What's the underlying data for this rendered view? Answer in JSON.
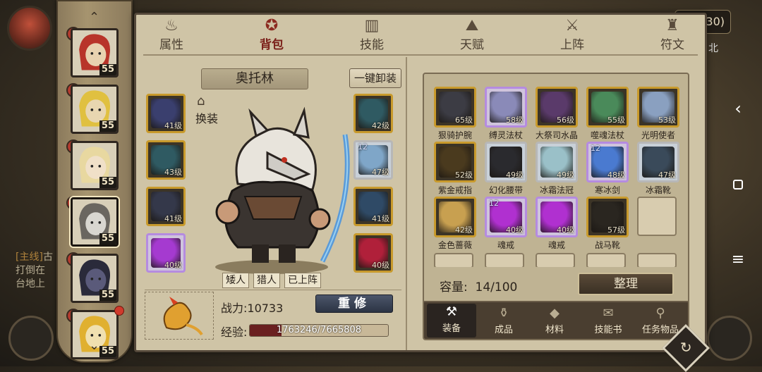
{
  "background": {
    "coords": "05,30)",
    "north_label": "北",
    "chat_lines": [
      {
        "tag": "[主线]",
        "text": "古"
      },
      {
        "tag": "",
        "text": "打倒在"
      },
      {
        "tag": "",
        "text": "台地上"
      }
    ]
  },
  "hero_strip": {
    "heroes": [
      {
        "level": "55",
        "palette": "red-hair",
        "selected": false
      },
      {
        "level": "55",
        "palette": "blond",
        "selected": false
      },
      {
        "level": "55",
        "palette": "elf",
        "selected": false
      },
      {
        "level": "55",
        "palette": "wolf",
        "selected": true
      },
      {
        "level": "55",
        "palette": "dark",
        "selected": false
      },
      {
        "level": "55",
        "palette": "gold",
        "selected": false
      }
    ]
  },
  "tabs": [
    {
      "label": "属性",
      "icon": "flame-icon",
      "glyph": "♨",
      "active": false
    },
    {
      "label": "背包",
      "icon": "backpack-icon",
      "glyph": "✪",
      "active": true
    },
    {
      "label": "技能",
      "icon": "book-icon",
      "glyph": "▥",
      "active": false
    },
    {
      "label": "天赋",
      "icon": "mountain-icon",
      "glyph": "⛰",
      "active": false
    },
    {
      "label": "上阵",
      "icon": "crossed-swords-icon",
      "glyph": "⚔",
      "active": false
    },
    {
      "label": "符文",
      "icon": "rune-icon",
      "glyph": "♜",
      "active": false
    }
  ],
  "hero": {
    "name": "奥托林",
    "unequip_all": "一键卸装",
    "swap_label": "换装",
    "tags": [
      "矮人",
      "猎人",
      "已上阵"
    ],
    "power_label": "战力:10733",
    "rebuild_label": "重修",
    "exp_label": "经验:",
    "exp_text": "1763246/7665808",
    "exp_fraction": 0.23
  },
  "equipped_left": [
    {
      "level": "41级",
      "rarity": "gold",
      "color": "#3a3f6e"
    },
    {
      "level": "43级",
      "rarity": "gold",
      "color": "#2f5a62"
    },
    {
      "level": "41级",
      "rarity": "gold",
      "color": "#34384a"
    },
    {
      "level": "40级",
      "rarity": "purple",
      "color": "#a53ad0"
    }
  ],
  "equipped_right": [
    {
      "level": "42级",
      "rarity": "gold",
      "color": "#2f5a62",
      "plus": ""
    },
    {
      "level": "47级",
      "rarity": "blue",
      "color": "#7fa6c8",
      "plus": "12"
    },
    {
      "level": "41级",
      "rarity": "gold",
      "color": "#2f4a66",
      "plus": ""
    },
    {
      "level": "40级",
      "rarity": "gold",
      "color": "#b0203a",
      "plus": ""
    }
  ],
  "bag": {
    "items": [
      {
        "name": "狠骑护腕",
        "level": "65级",
        "rarity": "gold",
        "color": "#3c3c44",
        "plus": ""
      },
      {
        "name": "缚灵法杖",
        "level": "58级",
        "rarity": "purple",
        "color": "#8a8ab8",
        "plus": ""
      },
      {
        "name": "大祭司水晶",
        "level": "56级",
        "rarity": "gold",
        "color": "#5a3a6a",
        "plus": ""
      },
      {
        "name": "噬魂法杖",
        "level": "55级",
        "rarity": "gold",
        "color": "#4a8a5a",
        "plus": ""
      },
      {
        "name": "光明使者",
        "level": "53级",
        "rarity": "gold",
        "color": "#8aa0c0",
        "plus": ""
      },
      {
        "name": "紫金戒指",
        "level": "52级",
        "rarity": "gold",
        "color": "#4a3a1e",
        "plus": ""
      },
      {
        "name": "幻化腰带",
        "level": "49级",
        "rarity": "gray",
        "color": "#2a2a2e",
        "plus": ""
      },
      {
        "name": "冰霜法冠",
        "level": "49级",
        "rarity": "green",
        "color": "#9ac0c8",
        "plus": ""
      },
      {
        "name": "寒冰剑",
        "level": "48级",
        "rarity": "purple",
        "color": "#4a7ad0",
        "plus": "12"
      },
      {
        "name": "冰霜靴",
        "level": "47级",
        "rarity": "green",
        "color": "#3a4a5a",
        "plus": ""
      },
      {
        "name": "金色蔷薇",
        "level": "42级",
        "rarity": "gold",
        "color": "#c8a050",
        "plus": ""
      },
      {
        "name": "魂戒",
        "level": "40级",
        "rarity": "purple",
        "color": "#b030d0",
        "plus": "12"
      },
      {
        "name": "魂戒",
        "level": "40级",
        "rarity": "purple",
        "color": "#b030d0",
        "plus": ""
      },
      {
        "name": "战马靴",
        "level": "57级",
        "rarity": "gold",
        "color": "#2a2620",
        "plus": ""
      }
    ],
    "capacity_label": "容量:",
    "capacity": "14/100",
    "sort_label": "整理",
    "tabs": [
      {
        "label": "装备",
        "icon": "hammer-icon",
        "glyph": "⚒",
        "active": true
      },
      {
        "label": "成品",
        "icon": "pouch-icon",
        "glyph": "⚱",
        "active": false
      },
      {
        "label": "材料",
        "icon": "ore-icon",
        "glyph": "◆",
        "active": false
      },
      {
        "label": "技能书",
        "icon": "scroll-icon",
        "glyph": "✉",
        "active": false
      },
      {
        "label": "任务物品",
        "icon": "quest-bag-icon",
        "glyph": "⚲",
        "active": false
      }
    ]
  },
  "colors": {
    "panel": "#cfc4a6",
    "gold_border": "#c89a2c",
    "purple_border": "#b58be0",
    "active_tab": "#7a1e18"
  }
}
